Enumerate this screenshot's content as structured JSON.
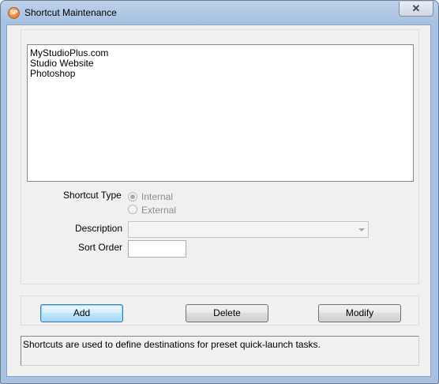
{
  "window": {
    "title": "Shortcut Maintenance",
    "close_glyph": "✕",
    "app_icon_text": "SP"
  },
  "shortcuts": {
    "items": [
      "MyStudioPlus.com",
      "Studio Website",
      "Photoshop"
    ]
  },
  "form": {
    "shortcut_type_label": "Shortcut Type",
    "type_options": [
      {
        "label": "Internal",
        "checked": true
      },
      {
        "label": "External",
        "checked": false
      }
    ],
    "description_label": "Description",
    "description_value": "",
    "sort_order_label": "Sort Order",
    "sort_order_value": ""
  },
  "buttons": {
    "add": "Add",
    "delete": "Delete",
    "modify": "Modify"
  },
  "status": {
    "text": "Shortcuts are used to define destinations for preset quick-launch tasks."
  },
  "icons": {
    "app": "studioplus-app-icon",
    "close": "close-icon",
    "dropdown": "chevron-down-icon"
  },
  "colors": {
    "title_bar": "#a7c1e1",
    "dialog_bg": "#f0f0f0",
    "default_button": "#bee6fd"
  }
}
